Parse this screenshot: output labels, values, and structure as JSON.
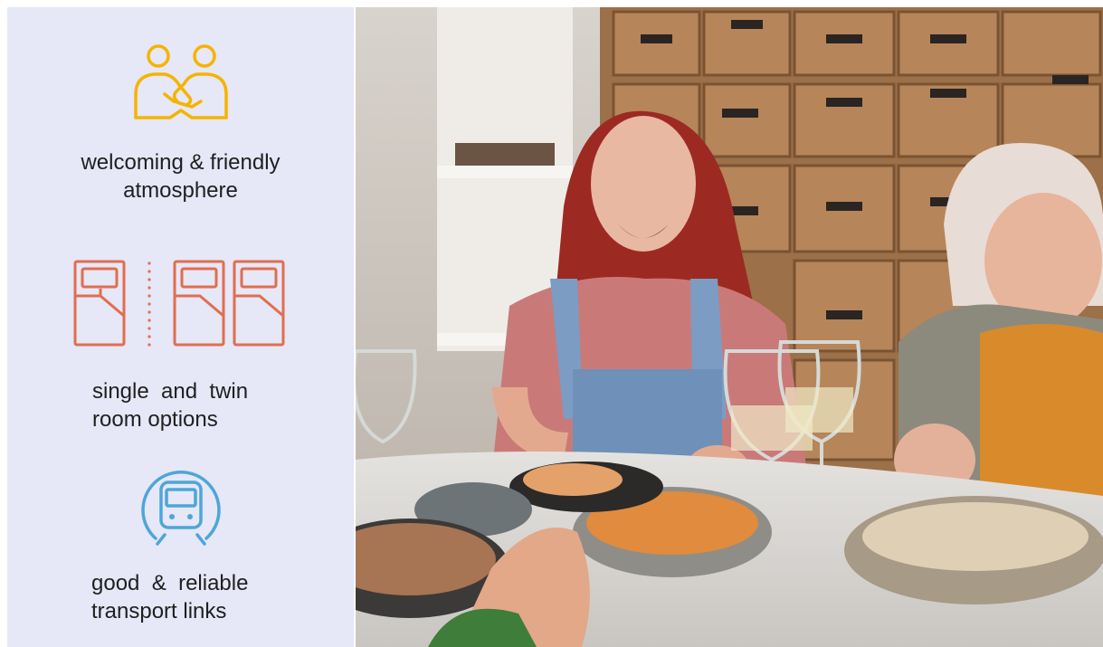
{
  "features": [
    {
      "icon": "handshake-icon",
      "label_lines": [
        "welcoming & friendly",
        "atmosphere"
      ],
      "color": "#f5b400"
    },
    {
      "icon": "bed-icon",
      "label_lines": [
        "single  and  twin",
        "room options"
      ],
      "color": "#e06e4f"
    },
    {
      "icon": "train-icon",
      "label_lines": [
        "good  &  reliable",
        "transport links"
      ],
      "color": "#4da6d9"
    }
  ],
  "colors": {
    "panel_bg": "#e6e7f7",
    "text": "#1f1f1f"
  }
}
